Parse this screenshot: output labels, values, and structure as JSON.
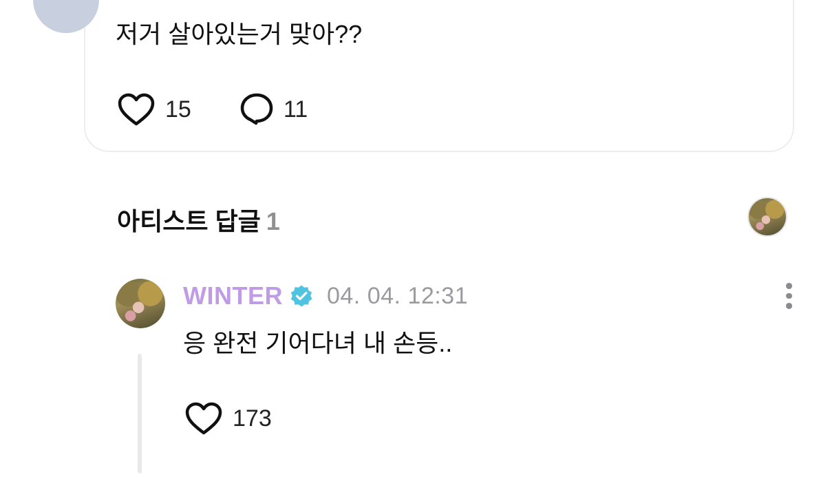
{
  "post": {
    "text": "저거 살아있는거 맞아??",
    "like_count": "15",
    "comment_count": "11",
    "icons": {
      "like": "heart-icon",
      "comment": "comment-bubble-icon"
    }
  },
  "artist_replies": {
    "title": "아티스트 답글",
    "count": "1",
    "header_avatar": "artist-avatar"
  },
  "reply": {
    "author": "WINTER",
    "verified_icon": "verified-badge-icon",
    "timestamp": "04. 04. 12:31",
    "text": "응 완전 기어다녀 내 손등..",
    "like_count": "173",
    "menu_icon": "more-vertical-icon"
  },
  "colors": {
    "author": "#c19ce6",
    "verified": "#4fc3e0",
    "muted_text": "#9a9a9f",
    "card_border": "#ecedf2",
    "thread_line": "#e9e9ed"
  }
}
